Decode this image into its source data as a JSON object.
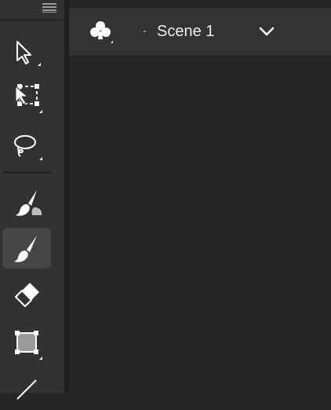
{
  "scene_bar": {
    "title": "Scene 1",
    "symbol_icon": "club-icon",
    "dropdown_icon": "chevron-down-icon"
  },
  "toolbar": {
    "menu_icon": "panel-menu-icon",
    "tools": [
      {
        "name": "selection-tool",
        "icon": "arrow-icon",
        "selected": false
      },
      {
        "name": "free-transform-tool",
        "icon": "transform-icon",
        "selected": false
      },
      {
        "name": "lasso-tool",
        "icon": "lasso-icon",
        "selected": false
      },
      {
        "name": "fluid-brush-tool",
        "icon": "fluid-brush-icon",
        "selected": false
      },
      {
        "name": "classic-brush-tool",
        "icon": "brush-icon",
        "selected": true
      },
      {
        "name": "eraser-tool",
        "icon": "eraser-icon",
        "selected": false
      },
      {
        "name": "rectangle-tool",
        "icon": "rectangle-icon",
        "selected": false
      },
      {
        "name": "line-tool",
        "icon": "line-icon",
        "selected": false
      }
    ]
  },
  "colors": {
    "toolbar_bg": "#323232",
    "stage_bg": "#262626",
    "scene_bar_bg": "#333333",
    "selected_tool_bg": "#464646",
    "icon": "#ffffff"
  }
}
